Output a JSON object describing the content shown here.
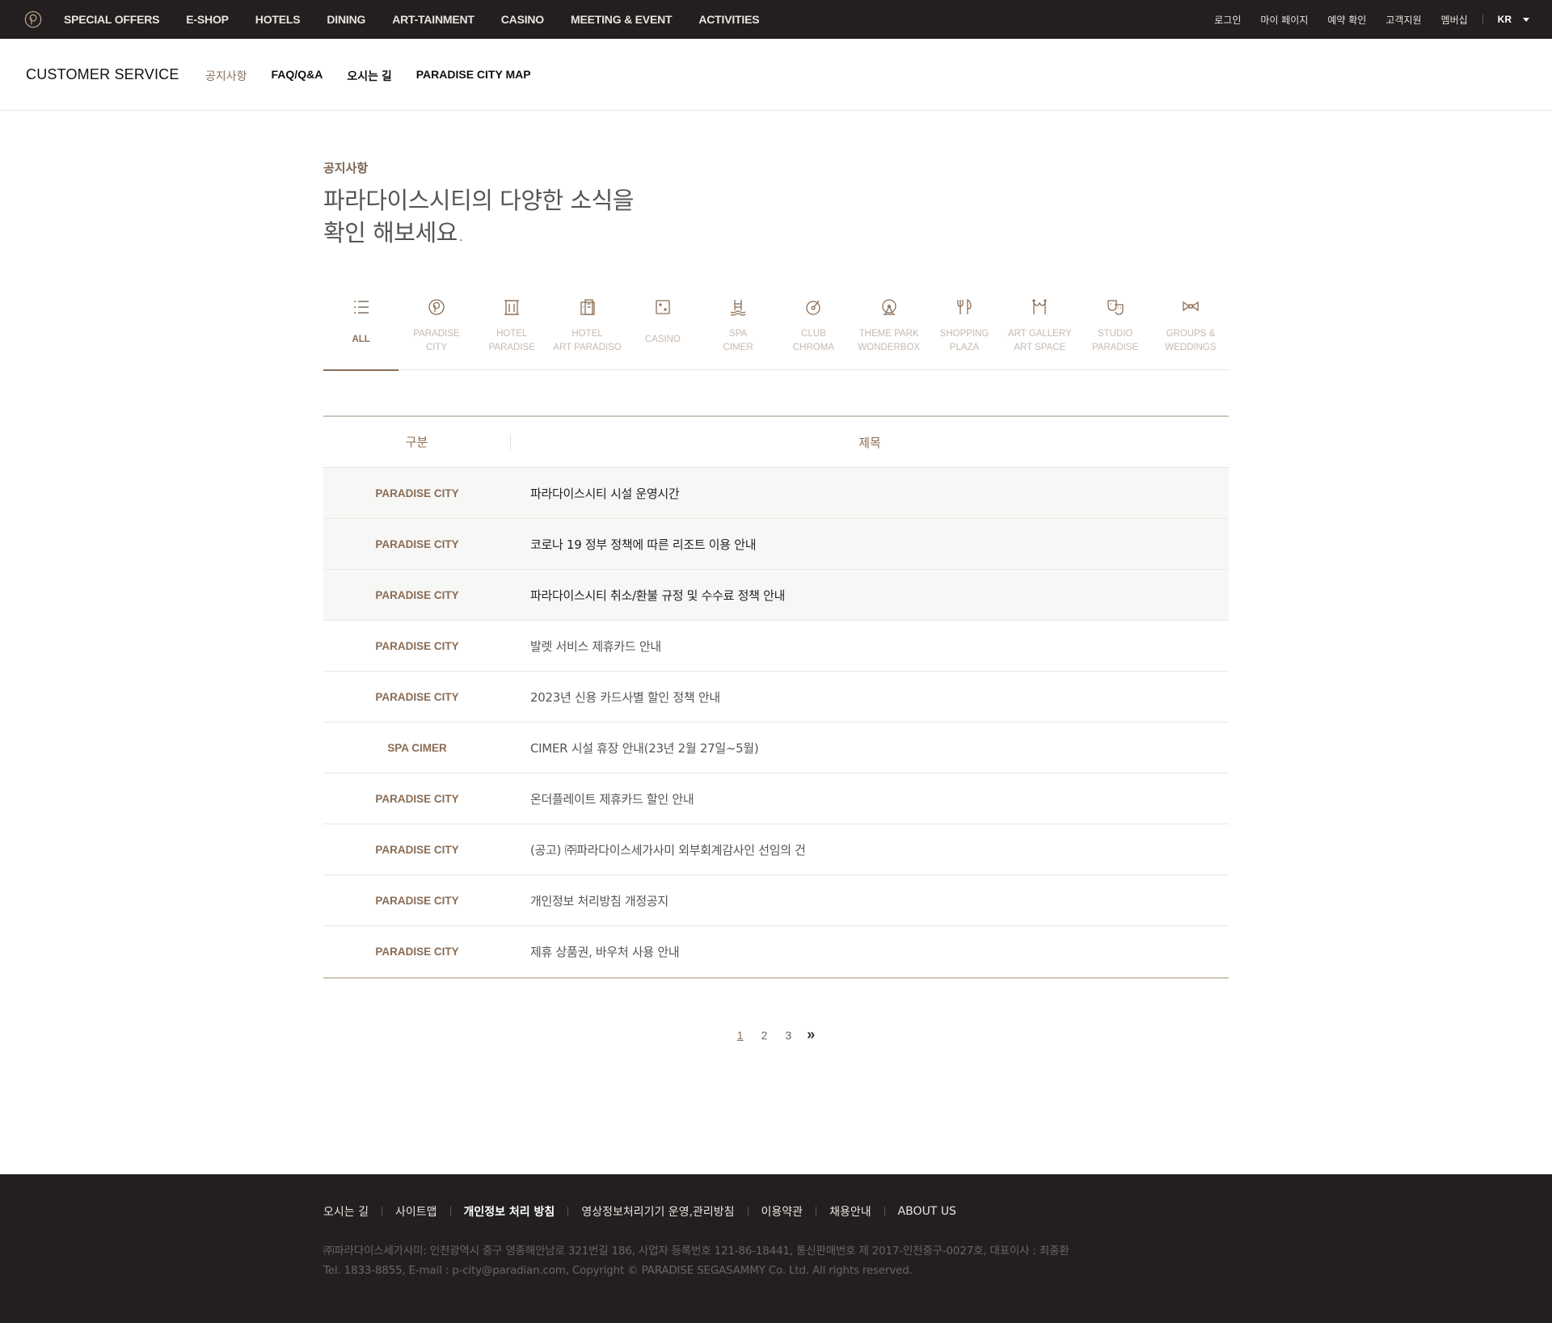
{
  "gnb": {
    "logo": "paradise-logo",
    "items": [
      "SPECIAL OFFERS",
      "E-SHOP",
      "HOTELS",
      "DINING",
      "ART-TAINMENT",
      "CASINO",
      "MEETING & EVENT",
      "ACTIVITIES"
    ]
  },
  "util": {
    "items": [
      "로그인",
      "마이 페이지",
      "예약 확인",
      "고객지원",
      "멤버십"
    ],
    "lang": "KR"
  },
  "subheader": {
    "title": "CUSTOMER SERVICE",
    "tabs": [
      "공지사항",
      "FAQ/Q&A",
      "오시는 길",
      "PARADISE CITY MAP"
    ],
    "active_tab": "공지사항"
  },
  "intro": {
    "crumb": "공지사항",
    "headline_line1": "파라다이스시티의 다양한 소식을",
    "headline_line2": "확인 해보세요."
  },
  "categories": [
    {
      "line1": "ALL",
      "line2": "",
      "icon": "list-icon",
      "active": true
    },
    {
      "line1": "PARADISE",
      "line2": "CITY",
      "icon": "paradise-logo-icon"
    },
    {
      "line1": "HOTEL",
      "line2": "PARADISE",
      "icon": "hotel-building-icon"
    },
    {
      "line1": "HOTEL",
      "line2": "ART PARADISO",
      "icon": "art-hotel-icon"
    },
    {
      "line1": "CASINO",
      "line2": "",
      "icon": "dice-icon"
    },
    {
      "line1": "SPA",
      "line2": "CIMER",
      "icon": "spa-icon"
    },
    {
      "line1": "CLUB",
      "line2": "CHROMA",
      "icon": "vinyl-record-icon"
    },
    {
      "line1": "THEME PARK",
      "line2": "WONDERBOX",
      "icon": "ferris-wheel-icon"
    },
    {
      "line1": "SHOPPING",
      "line2": "PLAZA",
      "icon": "fork-knife-icon"
    },
    {
      "line1": "ART GALLERY",
      "line2": "ART SPACE",
      "icon": "gallery-arch-icon"
    },
    {
      "line1": "STUDIO",
      "line2": "PARADISE",
      "icon": "theater-masks-icon"
    },
    {
      "line1": "GROUPS &",
      "line2": "WEDDINGS",
      "icon": "bow-tie-icon"
    }
  ],
  "table": {
    "headers": [
      "구분",
      "제목"
    ],
    "rows": [
      {
        "category": "PARADISE CITY",
        "title": "파라다이스시티 시설 운영시간",
        "pinned": true
      },
      {
        "category": "PARADISE CITY",
        "title": "코로나 19 정부 정책에 따른 리조트 이용 안내",
        "pinned": true
      },
      {
        "category": "PARADISE CITY",
        "title": "파라다이스시티 취소/환불 규정 및 수수료 정책 안내",
        "pinned": true
      },
      {
        "category": "PARADISE CITY",
        "title": "발렛 서비스 제휴카드 안내"
      },
      {
        "category": "PARADISE CITY",
        "title": "2023년 신용 카드사별 할인 정책 안내"
      },
      {
        "category": "SPA CIMER",
        "title": "CIMER 시설 휴장 안내(23년 2월 27일~5월)"
      },
      {
        "category": "PARADISE CITY",
        "title": "온더플레이트 제휴카드 할인 안내"
      },
      {
        "category": "PARADISE CITY",
        "title": "(공고) ㈜파라다이스세가사미 외부회계감사인 선임의 건"
      },
      {
        "category": "PARADISE CITY",
        "title": "개인정보 처리방침 개정공지"
      },
      {
        "category": "PARADISE CITY",
        "title": "제휴 상품권, 바우처 사용 안내"
      }
    ]
  },
  "pagination": {
    "pages": [
      "1",
      "2",
      "3"
    ],
    "current": "1",
    "next": "»"
  },
  "footer": {
    "links": [
      "오시는 길",
      "사이트맵",
      "개인정보 처리 방침",
      "영상정보처리기기 운영,관리방침",
      "이용약관",
      "채용안내",
      "ABOUT US"
    ],
    "bold_link": "개인정보 처리 방침",
    "info_line1": "㈜파라다이스세가사미: 인천광역시 중구 영종해안남로 321번길 186, 사업자 등록번호 121-86-18441, 통신판매번호 제 2017-인천중구-0027호, 대표이사 : 최종환",
    "info_line2": "Tel. 1833-8855, E-mail : p-city@paradian.com, Copyright © PARADISE SEGASAMMY Co. Ltd. All rights reserved."
  },
  "colors": {
    "accent": "#8a6d55",
    "dark": "#231f20",
    "muted": "#c6bab0"
  }
}
